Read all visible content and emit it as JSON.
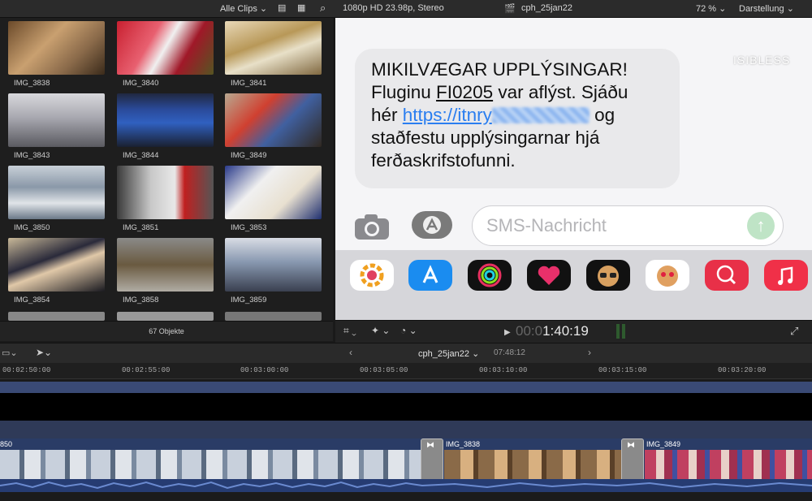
{
  "browser": {
    "filter_label": "Alle Clips",
    "clips": [
      "IMG_3838",
      "IMG_3840",
      "IMG_3841",
      "IMG_3843",
      "IMG_3844",
      "IMG_3849",
      "IMG_3850",
      "IMG_3851",
      "IMG_3853",
      "IMG_3854",
      "IMG_3858",
      "IMG_3859"
    ],
    "count_label": "67 Objekte"
  },
  "viewer": {
    "format": "1080p HD 23.98p, Stereo",
    "project": "cph_25jan22",
    "zoom": "72 %",
    "display_menu": "Darstellung",
    "watermark": "ISIBLESS",
    "message": {
      "line1": "MIKILVÆGAR UPPLÝSINGAR!",
      "line2a": "Fluginu ",
      "flight": "FI0205",
      "line2b": " var aflýst. Sjáðu",
      "line3a": "hér ",
      "link": "https://itnry",
      "line3b": " og",
      "line4": "staðfestu upplýsingarnar hjá",
      "line5": "ferðaskrifstofunni."
    },
    "sms_placeholder": "SMS-Nachricht",
    "timecode_dim": "00:0",
    "timecode": "1:40:19"
  },
  "timeline": {
    "project": "cph_25jan22",
    "duration": "07:48:12",
    "ticks": [
      "00:02:50:00",
      "00:02:55:00",
      "00:03:00:00",
      "00:03:05:00",
      "00:03:10:00",
      "00:03:15:00",
      "00:03:20:00"
    ],
    "left_clip_label": "850",
    "clip_a": "IMG_3838",
    "clip_b": "IMG_3849"
  }
}
